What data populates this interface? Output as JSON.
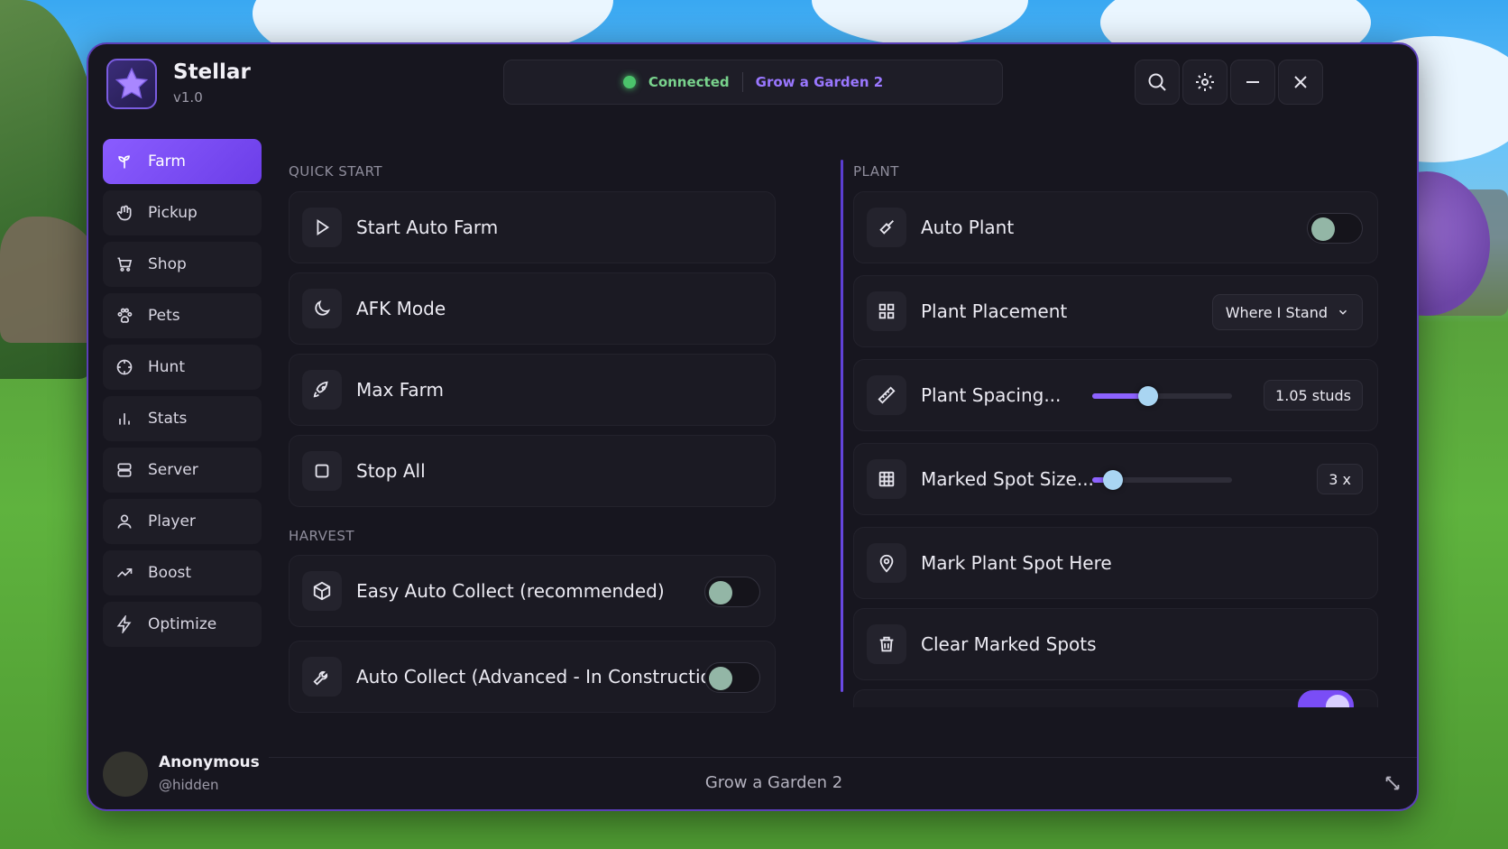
{
  "app": {
    "name": "Stellar",
    "version": "v1.0"
  },
  "status": {
    "connection": "Connected",
    "game": "Grow a Garden 2"
  },
  "header_buttons": [
    {
      "name": "search",
      "icon": "search-icon"
    },
    {
      "name": "settings",
      "icon": "gear-icon"
    },
    {
      "name": "minimize",
      "icon": "minimize-icon"
    },
    {
      "name": "close",
      "icon": "close-icon"
    }
  ],
  "sidebar": {
    "items": [
      {
        "label": "Farm",
        "icon": "sprout-icon",
        "active": true
      },
      {
        "label": "Pickup",
        "icon": "hand-icon"
      },
      {
        "label": "Shop",
        "icon": "cart-icon"
      },
      {
        "label": "Pets",
        "icon": "paw-icon"
      },
      {
        "label": "Hunt",
        "icon": "crosshair-icon"
      },
      {
        "label": "Stats",
        "icon": "bar-chart-icon"
      },
      {
        "label": "Server",
        "icon": "server-icon"
      },
      {
        "label": "Player",
        "icon": "user-icon"
      },
      {
        "label": "Boost",
        "icon": "trend-up-icon"
      },
      {
        "label": "Optimize",
        "icon": "lightning-icon"
      }
    ]
  },
  "quick_start": {
    "title": "QUICK START",
    "items": [
      {
        "label": "Start Auto Farm",
        "icon": "play-icon"
      },
      {
        "label": "AFK Mode",
        "icon": "moon-icon"
      },
      {
        "label": "Max Farm",
        "icon": "rocket-icon"
      },
      {
        "label": "Stop All",
        "icon": "stop-icon"
      }
    ]
  },
  "harvest": {
    "title": "HARVEST",
    "items": [
      {
        "label": "Easy Auto Collect (recommended)",
        "icon": "cube-icon",
        "enabled": false
      },
      {
        "label": "Auto Collect (Advanced - In Construction)",
        "icon": "wrench-icon",
        "enabled": false
      }
    ]
  },
  "plant": {
    "title": "PLANT",
    "auto_plant": {
      "label": "Auto Plant",
      "icon": "shovel-icon",
      "enabled": false
    },
    "placement": {
      "label": "Plant Placement",
      "icon": "grid-icon",
      "value": "Where I Stand"
    },
    "spacing": {
      "label": "Plant Spacing...",
      "icon": "ruler-icon",
      "value_text": "1.05 studs",
      "level": 0.4
    },
    "marked_size": {
      "label": "Marked Spot Size...",
      "icon": "grid-3x3-icon",
      "value_text": "3 x",
      "level": 0.15
    },
    "mark_here": {
      "label": "Mark Plant Spot Here",
      "icon": "map-pin-icon"
    },
    "clear_marked": {
      "label": "Clear Marked Spots",
      "icon": "trash-icon"
    }
  },
  "user": {
    "name": "Anonymous",
    "handle": "@hidden"
  },
  "footer": {
    "title": "Grow a Garden 2"
  },
  "colors": {
    "accent": "#7a4df6",
    "connected": "#4bc36b",
    "window_bg": "#17161f"
  }
}
